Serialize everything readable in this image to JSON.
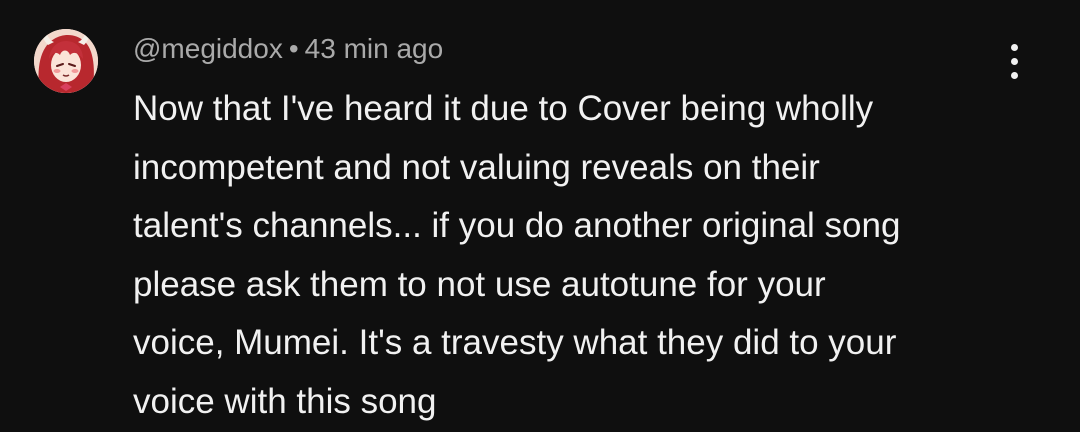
{
  "comment": {
    "author": "@megiddox",
    "separator": "•",
    "timestamp": "43 min ago",
    "avatar_icon": "anime-avatar-icon",
    "menu_icon": "more-vert-icon",
    "body_lines": [
      "Now that I've heard it due to Cover being wholly",
      "incompetent and not valuing reveals on their",
      "talent's channels... if you do another original song",
      "please ask them to not use autotune for your",
      "voice, Mumei. It's a travesty what they did to your",
      "voice with this song"
    ]
  },
  "colors": {
    "background": "#0f0f0f",
    "primary_text": "#f1f1f1",
    "secondary_text": "#aaaaaa"
  }
}
